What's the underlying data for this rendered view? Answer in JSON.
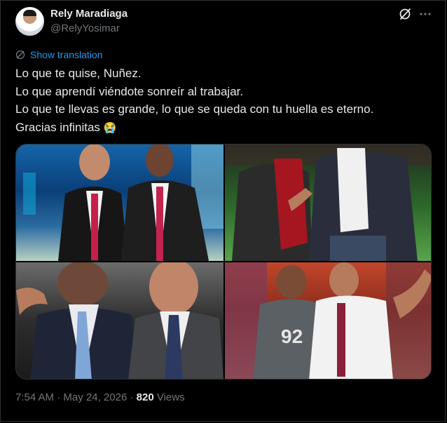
{
  "author": {
    "display_name": "Rely Maradiaga",
    "handle": "@RelyYosimar"
  },
  "actions": {
    "grok_icon": "grok-icon",
    "more_icon": "more-icon"
  },
  "translate": {
    "label": "Show translation",
    "icon": "globe-icon"
  },
  "tweet": {
    "lines": [
      "Lo que te quise, Nuñez.",
      "Lo que aprendí viéndote sonreír al trabajar.",
      "Lo que te llevas es grande, lo que se queda con tu huella es eterno.",
      "Gracias infinitas"
    ],
    "emoji": "😭"
  },
  "media": {
    "count": 4
  },
  "meta": {
    "time": "7:54 AM",
    "separator": "·",
    "date": "May 24, 2026",
    "views_count": "820",
    "views_label": "Views"
  },
  "colors": {
    "background": "#000000",
    "text": "#e7e9ea",
    "secondary": "#71767b",
    "accent": "#1d9bf0",
    "border": "#2f3336"
  }
}
